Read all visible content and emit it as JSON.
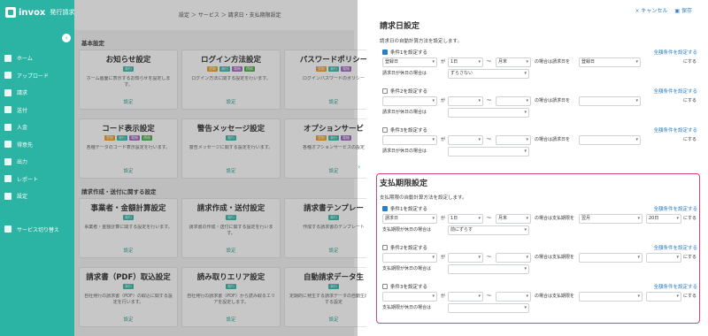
{
  "app": {
    "logo": "invox",
    "sub": "発行請求書"
  },
  "sidebar": {
    "items": [
      {
        "label": "ホーム"
      },
      {
        "label": "アップロード"
      },
      {
        "label": "請求"
      },
      {
        "label": "送付"
      },
      {
        "label": "入金"
      },
      {
        "label": "得意先"
      },
      {
        "label": "出力"
      },
      {
        "label": "レポート"
      },
      {
        "label": "設定"
      }
    ],
    "switch": "サービス切り替え"
  },
  "breadcrumb": "設定 ＞ サービス ＞ 請求日・支払期限設定",
  "sections": {
    "basic": "基本設定",
    "invoice": "請求作成・送付に関する設定"
  },
  "cards": [
    {
      "title": "お知らせ設定",
      "tags": [
        {
          "t": "発行",
          "c": "t"
        }
      ],
      "desc": "ホーム画面に表示するお知らせを設定します。",
      "btn": "設定"
    },
    {
      "title": "ログイン方法設定",
      "tags": [
        {
          "t": "受取",
          "c": "o"
        },
        {
          "t": "発行",
          "c": "t"
        },
        {
          "t": "電帳",
          "c": "p"
        },
        {
          "t": "債務",
          "c": "g"
        }
      ],
      "desc": "ログイン方法に関する設定を行います。",
      "btn": "設定"
    },
    {
      "title": "パスワードポリシー",
      "tags": [
        {
          "t": "受取",
          "c": "o"
        },
        {
          "t": "発行",
          "c": "t"
        },
        {
          "t": "電帳",
          "c": "p"
        }
      ],
      "desc": "ログインパスワードのポリシー",
      "btn": "設定"
    },
    {
      "title": "コード表示設定",
      "tags": [
        {
          "t": "受取",
          "c": "o"
        },
        {
          "t": "発行",
          "c": "t"
        },
        {
          "t": "電帳",
          "c": "p"
        },
        {
          "t": "債務",
          "c": "g"
        }
      ],
      "desc": "各種データのコード表示設定を行います。",
      "btn": "設定"
    },
    {
      "title": "警告メッセージ設定",
      "tags": [
        {
          "t": "発行",
          "c": "t"
        }
      ],
      "desc": "警告メッセージに関する設定を行います。",
      "btn": "設定"
    },
    {
      "title": "オプションサービ",
      "tags": [
        {
          "t": "受取",
          "c": "o"
        },
        {
          "t": "発行",
          "c": "t"
        },
        {
          "t": "電帳",
          "c": "p"
        }
      ],
      "desc": "各種オプションサービスの設定",
      "btn": "設定"
    },
    {
      "title": "事業者・金額計算設定",
      "tags": [
        {
          "t": "発行",
          "c": "t"
        }
      ],
      "desc": "事業者・金額計算に関する設定を行います。",
      "btn": "設定"
    },
    {
      "title": "請求作成・送付設定",
      "tags": [
        {
          "t": "発行",
          "c": "t"
        }
      ],
      "desc": "請求書の作成・送付に関する設定を行います。",
      "btn": "設定"
    },
    {
      "title": "請求書テンプレー",
      "tags": [
        {
          "t": "発行",
          "c": "t"
        }
      ],
      "desc": "作成する請求書のテンプレート",
      "btn": "設定"
    },
    {
      "title": "請求書（PDF）取込設定",
      "tags": [
        {
          "t": "発行",
          "c": "t"
        }
      ],
      "desc": "自社発行の請求書（PDF）の取込に関する設定を行います。",
      "btn": "設定"
    },
    {
      "title": "読み取りエリア設定",
      "tags": [
        {
          "t": "発行",
          "c": "t"
        }
      ],
      "desc": "自社発行の請求書（PDF）から読み取るエリアを設定します。",
      "btn": "設定"
    },
    {
      "title": "自動請求データ生",
      "tags": [
        {
          "t": "発行",
          "c": "t"
        }
      ],
      "desc": "定期的に発生する請求データの自動生成に関する設定",
      "btn": "設定"
    }
  ],
  "panel": {
    "cancel": "× キャンセル",
    "save": "保存",
    "billing": {
      "title": "請求日設定",
      "desc": "請求日の自動計算方法を設定します。",
      "conds": [
        {
          "label": "条件1を設定する",
          "checked": true,
          "link": "全額条件を設定する",
          "s1": "登録日",
          "s2": "1日",
          "s3": "月末",
          "mid": "の場合は請求日を",
          "s4": "登録日",
          "end": "にする",
          "holiday": "請求日が休日の場合は",
          "s5": "ずらさない"
        },
        {
          "label": "条件2を設定する",
          "checked": false,
          "link": "全額条件を設定する",
          "s1": "",
          "s2": "",
          "s3": "",
          "mid": "の場合は請求日を",
          "s4": "",
          "end": "にする",
          "holiday": "請求日が休日の場合は",
          "s5": ""
        },
        {
          "label": "条件3を設定する",
          "checked": false,
          "link": "全額条件を設定する",
          "s1": "",
          "s2": "",
          "s3": "",
          "mid": "の場合は請求日を",
          "s4": "",
          "end": "にする",
          "holiday": "請求日が休日の場合は",
          "s5": ""
        }
      ]
    },
    "due": {
      "title": "支払期限設定",
      "desc": "支払期限の自動計算方法を設定します。",
      "conds": [
        {
          "label": "条件1を設定する",
          "checked": true,
          "link": "全額条件を設定する",
          "s1": "請求日",
          "s2": "1日",
          "s3": "月末",
          "mid": "の場合は支払期限を",
          "s4": "翌月",
          "s6": "20日",
          "end": "にする",
          "holiday": "支払期限が休日の場合は",
          "s5": "前にずらす"
        },
        {
          "label": "条件2を設定する",
          "checked": false,
          "link": "全額条件を設定する",
          "s1": "",
          "s2": "",
          "s3": "",
          "mid": "の場合は支払期限を",
          "s4": "",
          "s6": "",
          "end": "にする",
          "holiday": "支払期限が休日の場合は",
          "s5": ""
        },
        {
          "label": "条件3を設定する",
          "checked": false,
          "link": "全額条件を設定する",
          "s1": "",
          "s2": "",
          "s3": "",
          "mid": "の場合は支払期限を",
          "s4": "",
          "s6": "",
          "end": "にする",
          "holiday": "支払期限が休日の場合は",
          "s5": ""
        }
      ]
    },
    "ga": "が",
    "tilde": "〜"
  }
}
